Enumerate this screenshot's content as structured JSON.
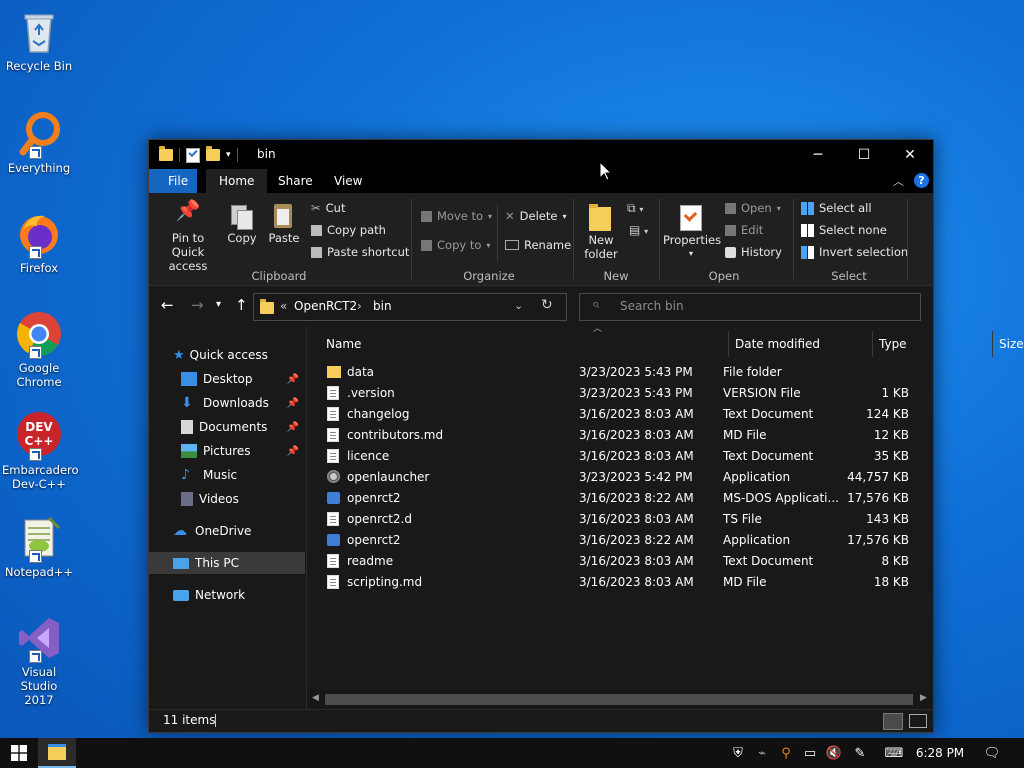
{
  "desktop": {
    "icons": [
      {
        "label": "Recycle Bin"
      },
      {
        "label": "Everything"
      },
      {
        "label": "Firefox"
      },
      {
        "label": "Google\nChrome"
      },
      {
        "label": "Embarcadero\nDev-C++"
      },
      {
        "label": "Notepad++"
      },
      {
        "label": "Visual Studio\n2017"
      }
    ],
    "devcpp_logo_text": "DEV\nC++"
  },
  "window": {
    "title": "bin",
    "controls": {
      "minimize": "─",
      "maximize": "☐",
      "close": "✕"
    },
    "tabs": {
      "file": "File",
      "home": "Home",
      "share": "Share",
      "view": "View"
    },
    "ribbon": {
      "clipboard": {
        "pin_label": "Pin to Quick\naccess",
        "copy_label": "Copy",
        "paste_label": "Paste",
        "cut_label": "Cut",
        "copy_path_label": "Copy path",
        "paste_shortcut_label": "Paste shortcut",
        "group_label": "Clipboard"
      },
      "organize": {
        "move_to_label": "Move to",
        "copy_to_label": "Copy to",
        "delete_label": "Delete",
        "rename_label": "Rename",
        "group_label": "Organize"
      },
      "new": {
        "new_folder_label": "New\nfolder",
        "group_label": "New"
      },
      "open": {
        "properties_label": "Properties",
        "open_label": "Open",
        "edit_label": "Edit",
        "history_label": "History",
        "group_label": "Open"
      },
      "select": {
        "select_all_label": "Select all",
        "select_none_label": "Select none",
        "invert_selection_label": "Invert selection",
        "group_label": "Select"
      }
    },
    "address": {
      "overflow": "«",
      "crumbs": [
        "OpenRCT2",
        "bin"
      ],
      "separator": "›"
    },
    "search": {
      "placeholder": "Search bin"
    },
    "navpane": {
      "items": [
        {
          "label": "Quick access"
        },
        {
          "label": "Desktop"
        },
        {
          "label": "Downloads"
        },
        {
          "label": "Documents"
        },
        {
          "label": "Pictures"
        },
        {
          "label": "Music"
        },
        {
          "label": "Videos"
        },
        {
          "label": "OneDrive"
        },
        {
          "label": "This PC"
        },
        {
          "label": "Network"
        }
      ]
    },
    "columns": {
      "name": "Name",
      "date": "Date modified",
      "type": "Type",
      "size": "Size"
    },
    "files": [
      {
        "name": "data",
        "date": "3/23/2023 5:43 PM",
        "type": "File folder",
        "size": ""
      },
      {
        "name": ".version",
        "date": "3/23/2023 5:43 PM",
        "type": "VERSION File",
        "size": "1 KB"
      },
      {
        "name": "changelog",
        "date": "3/16/2023 8:03 AM",
        "type": "Text Document",
        "size": "124 KB"
      },
      {
        "name": "contributors.md",
        "date": "3/16/2023 8:03 AM",
        "type": "MD File",
        "size": "12 KB"
      },
      {
        "name": "licence",
        "date": "3/16/2023 8:03 AM",
        "type": "Text Document",
        "size": "35 KB"
      },
      {
        "name": "openlauncher",
        "date": "3/23/2023 5:42 PM",
        "type": "Application",
        "size": "44,757 KB"
      },
      {
        "name": "openrct2",
        "date": "3/16/2023 8:22 AM",
        "type": "MS-DOS Applicati...",
        "size": "17,576 KB"
      },
      {
        "name": "openrct2.d",
        "date": "3/16/2023 8:03 AM",
        "type": "TS File",
        "size": "143 KB"
      },
      {
        "name": "openrct2",
        "date": "3/16/2023 8:22 AM",
        "type": "Application",
        "size": "17,576 KB"
      },
      {
        "name": "readme",
        "date": "3/16/2023 8:03 AM",
        "type": "Text Document",
        "size": "8 KB"
      },
      {
        "name": "scripting.md",
        "date": "3/16/2023 8:03 AM",
        "type": "MD File",
        "size": "18 KB"
      }
    ],
    "status": {
      "item_count": "11 items"
    }
  },
  "taskbar": {
    "clock": "6:28 PM"
  },
  "colors": {
    "accent": "#1466c0",
    "folder": "#f5cf5a",
    "window_bg": "#191919",
    "ribbon_bg": "#202020"
  }
}
